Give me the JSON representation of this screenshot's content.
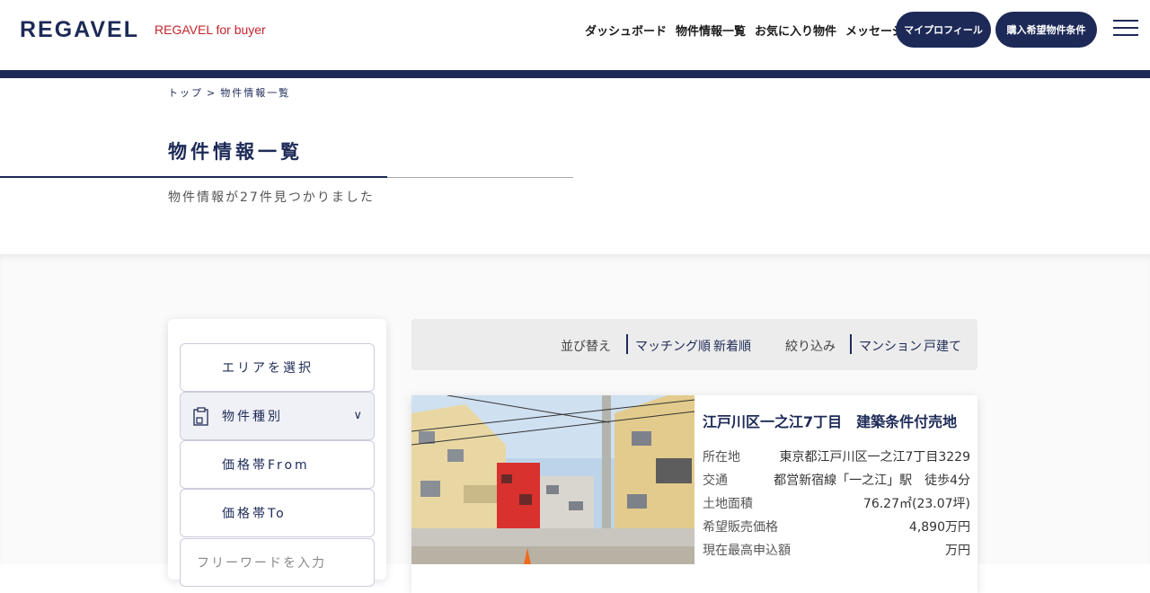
{
  "header": {
    "logo": "REGAVEL",
    "logo_sub": "REGAVEL for buyer",
    "nav": [
      "ダッシュボード",
      "物件情報一覧",
      "お気に入り物件",
      "メッセージ"
    ],
    "btn_profile": "マイプロフィール",
    "btn_conditions": "購入希望物件条件"
  },
  "breadcrumb": {
    "top": "トップ",
    "sep": ">",
    "current": "物件情報一覧"
  },
  "page": {
    "title": "物件情報一覧",
    "count_text": "物件情報が27件見つかりました"
  },
  "filters": {
    "area": "エリアを選択",
    "type": "物件種別",
    "price_from": "価格帯From",
    "price_to": "価格帯To",
    "freeword_placeholder": "フリーワードを入力"
  },
  "sortbar": {
    "sort_label": "並び替え",
    "sort_matching": "マッチング順",
    "sort_new": "新着順",
    "filter_label": "絞り込み",
    "filter_mansion": "マンション",
    "filter_house": "戸建て"
  },
  "listing": {
    "title": "江戸川区一之江7丁目　建築条件付売地",
    "rows": [
      {
        "k": "所在地",
        "v": "東京都江戸川区一之江7丁目3229"
      },
      {
        "k": "交通",
        "v": "都営新宿線「一之江」駅　徒歩4分"
      },
      {
        "k": "土地面積",
        "v": "76.27㎡(23.07坪)"
      },
      {
        "k": "希望販売価格",
        "v": "4,890万円"
      },
      {
        "k": "現在最高申込額",
        "v": "万円"
      }
    ]
  },
  "colors": {
    "navy": "#1d2a57",
    "brand_red": "#c4242c"
  }
}
